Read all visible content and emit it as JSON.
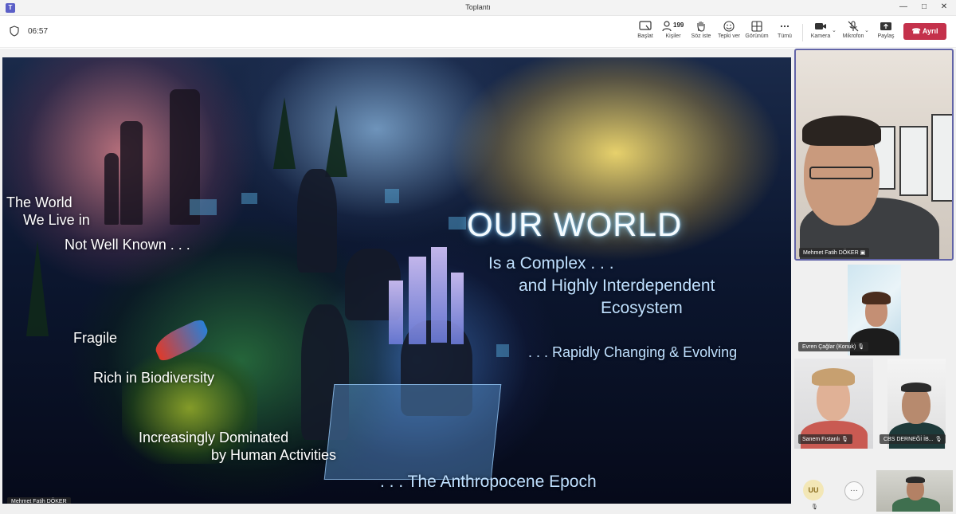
{
  "window": {
    "title": "Toplantı",
    "app_icon": "teams-icon"
  },
  "toolbar": {
    "timer": "06:57",
    "items": [
      {
        "label": "Başlat"
      },
      {
        "label": "Kişiler",
        "count": "199"
      },
      {
        "label": "Söz iste"
      },
      {
        "label": "Tepki ver"
      },
      {
        "label": "Görünüm"
      },
      {
        "label": "Tümü"
      },
      {
        "label": "Kamera"
      },
      {
        "label": "Mikrofon"
      },
      {
        "label": "Paylaş"
      }
    ],
    "leave_label": "Ayrıl",
    "leave_color": "#c4314b"
  },
  "slide": {
    "lines": [
      "The World",
      "We Live in",
      "Not Well Known . . .",
      "Fragile",
      "Rich in Biodiversity",
      "Increasingly Dominated",
      "by Human Activities",
      ". . . The Anthropocene Epoch"
    ],
    "headline": "OUR WORLD",
    "subheads": [
      "Is a Complex . . .",
      "and Highly Interdependent",
      "Ecosystem",
      ". . .  Rapidly Changing & Evolving"
    ],
    "presenter_tag": "Mehmet Fatih DÖKER"
  },
  "participants": [
    {
      "name": "Mehmet Fatih DÖKER",
      "status": "presenting"
    },
    {
      "name": "Evren Çağlar (Konuk)",
      "status": "muted"
    },
    {
      "name": "Sanem Fıstanlı",
      "status": "muted"
    },
    {
      "name": "CBS DERNEĞİ İB...",
      "status": "muted"
    }
  ],
  "avatar_initials": "UU",
  "more_label": "···"
}
